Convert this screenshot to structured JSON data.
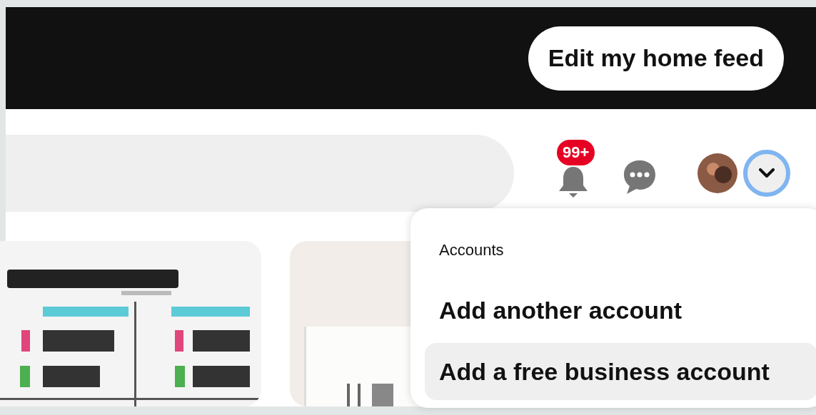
{
  "header": {
    "button": "Edit my home feed"
  },
  "nav": {
    "notifications_badge": "99+",
    "menu_expanded": true
  },
  "account_menu": {
    "section_title": "Accounts",
    "items": [
      {
        "label": "Add another account",
        "selected": false
      },
      {
        "label": "Add a free business account",
        "selected": true
      }
    ]
  }
}
